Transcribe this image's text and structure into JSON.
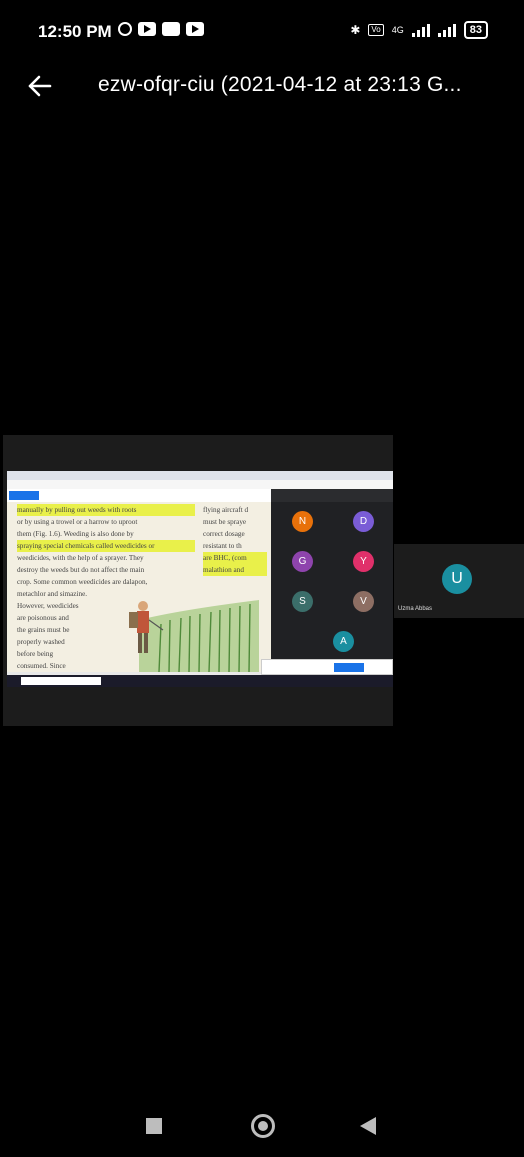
{
  "status_bar": {
    "time": "12:50 PM",
    "network": "4G",
    "battery": "83"
  },
  "header": {
    "title": "ezw-ofqr-ciu (2021-04-12 at 23:13 G..."
  },
  "shared_screen": {
    "doc_col1_lines": [
      "manually by pulling out weeds with roots",
      "or by using a trowel or a harrow to uproot",
      "them (Fig. 1.6). Weeding is also done by",
      "spraying special chemicals called weedicides or",
      "weedicides, with the help of a sprayer. They",
      "destroy the weeds but do not affect the main",
      "crop. Some common weedicides are dalapon,",
      "metachlor and simazine.",
      "However, weedicides",
      "are poisonous and",
      "the grains must be",
      "properly washed",
      "before being",
      "consumed. Since"
    ],
    "doc_col2_lines": [
      "flying aircraft d",
      "must be spraye",
      "correct dosage",
      "resistant to th",
      "are BHC, (com",
      "malathion and"
    ],
    "participants": [
      {
        "initial": "N",
        "color": "#e8710a"
      },
      {
        "initial": "D",
        "color": "#7a5cd6"
      },
      {
        "initial": "G",
        "color": "#8e44ad"
      },
      {
        "initial": "Y",
        "color": "#e0306a"
      },
      {
        "initial": "S",
        "color": "#3b6e6a"
      },
      {
        "initial": "V",
        "color": "#8d6e63"
      },
      {
        "initial": "A",
        "color": "#1a8fa0"
      }
    ]
  },
  "side_tile": {
    "initial": "U",
    "name": "Uzma Abbas"
  },
  "colors": {
    "background": "#000000",
    "avatar_teal": "#1a8fa0"
  }
}
